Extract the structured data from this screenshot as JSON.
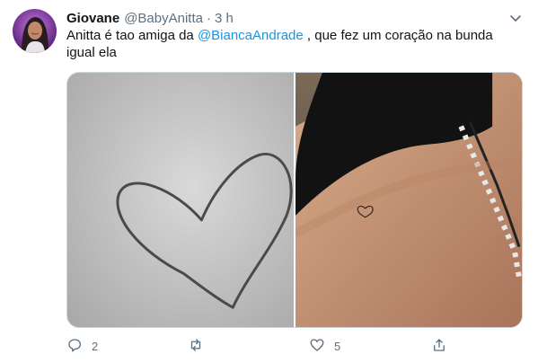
{
  "tweet": {
    "author_name": "Giovane",
    "author_handle": "@BabyAnitta",
    "separator": "·",
    "time": "3 h",
    "text_before": "Anitta é tao amiga da ",
    "mention": "@BiancaAndrade",
    "text_after": " , que fez um coração na bunda igual ela"
  },
  "media": {
    "images": [
      "heart-drawing",
      "heart-tattoo-photo"
    ]
  },
  "actions": {
    "reply_count": "2",
    "retweet_count": "",
    "like_count": "5"
  },
  "colors": {
    "text": "#0f1419",
    "muted": "#5b7083",
    "link": "#1b95e0",
    "border": "#ccd6dd"
  }
}
